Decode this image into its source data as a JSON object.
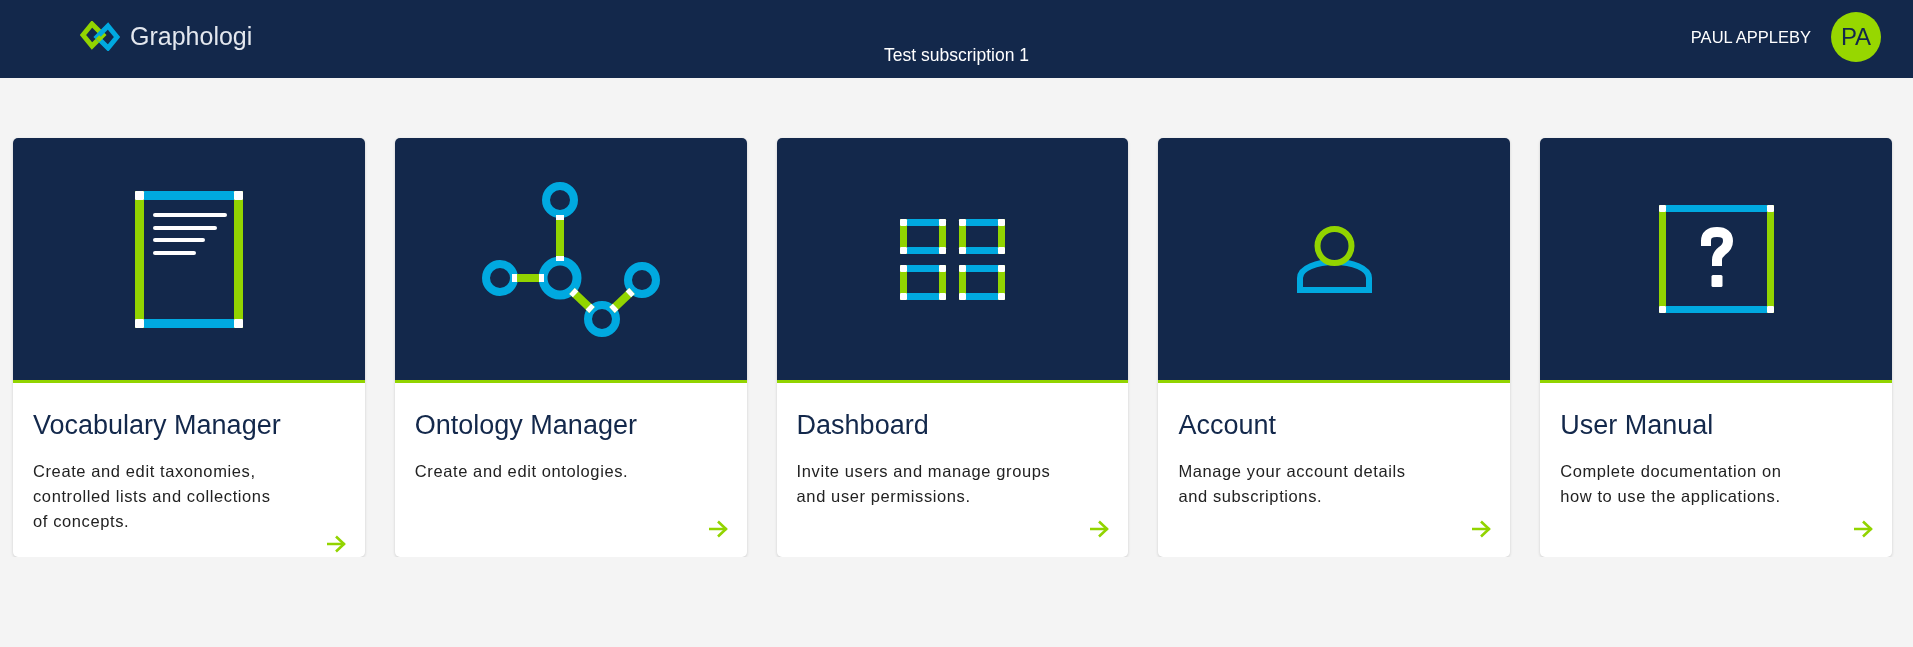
{
  "header": {
    "app_name": "Graphologi",
    "subscription": "Test subscription 1",
    "user_name": "PAUL APPLEBY",
    "avatar_initials": "PA"
  },
  "apps": [
    {
      "kind": "document",
      "title": "Vocabulary Manager",
      "description": "Create and edit taxonomies, controlled lists and collections of concepts."
    },
    {
      "kind": "graph",
      "title": "Ontology Manager",
      "description": "Create and edit ontologies."
    },
    {
      "kind": "grid",
      "title": "Dashboard",
      "description": "Invite users and manage groups and user permissions."
    },
    {
      "kind": "user",
      "title": "Account",
      "description": "Manage your account details and subscriptions."
    },
    {
      "kind": "help",
      "title": "User Manual",
      "description": "Complete documentation on how to use the applications."
    }
  ]
}
